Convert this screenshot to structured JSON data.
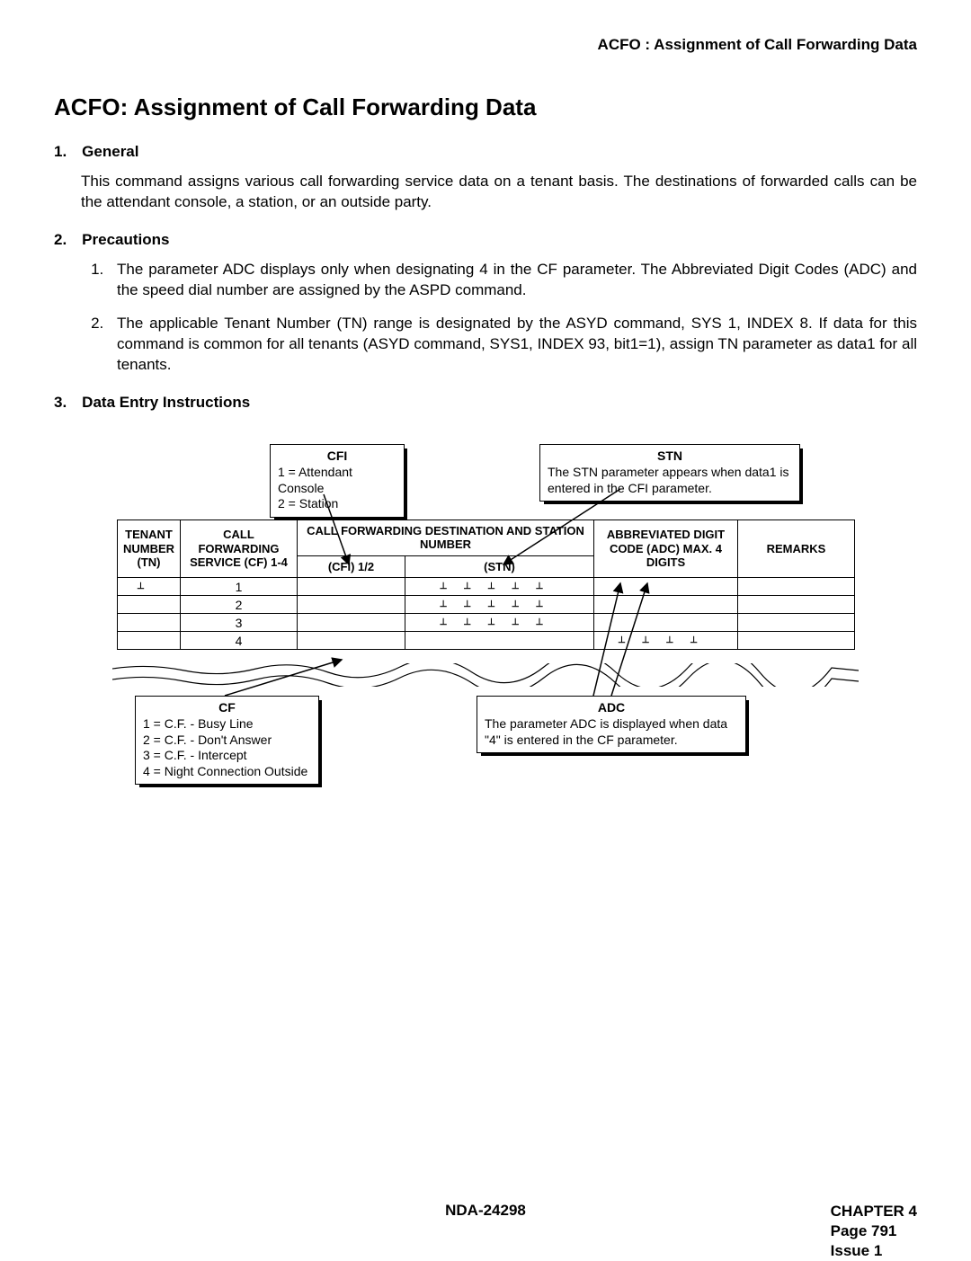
{
  "runningHeader": "ACFO : Assignment of Call Forwarding Data",
  "title": "ACFO: Assignment of Call Forwarding Data",
  "sections": {
    "general": {
      "heading": "1. General",
      "body": "This command assigns various call forwarding service data on a tenant basis. The destinations of forwarded calls can be the attendant console, a station, or an outside party."
    },
    "precautions": {
      "heading": "2. Precautions",
      "items": [
        "The parameter ADC displays only when designating 4 in the CF parameter. The Abbreviated Digit Codes (ADC) and the speed dial number are assigned by the ASPD command.",
        "The applicable Tenant Number (TN) range is designated by the ASYD command, SYS 1, INDEX 8. If data for this command is common for all tenants (ASYD command, SYS1, INDEX 93, bit1=1), assign TN parameter as data1 for all tenants."
      ]
    },
    "dataEntry": {
      "heading": "3. Data Entry Instructions"
    }
  },
  "callouts": {
    "cfi": {
      "title": "CFI",
      "lines": [
        "1 = Attendant Console",
        "2 = Station"
      ]
    },
    "stn": {
      "title": "STN",
      "lines": [
        "The STN parameter appears when data1 is entered in the CFI parameter."
      ]
    },
    "cf": {
      "title": "CF",
      "lines": [
        "1 = C.F. - Busy Line",
        "2 = C.F. - Don't Answer",
        "3 = C.F. - Intercept",
        "4 = Night Connection Outside"
      ]
    },
    "adc": {
      "title": "ADC",
      "lines": [
        "The parameter ADC is displayed when data \"4\" is entered in the CF parameter."
      ]
    }
  },
  "table": {
    "headers": {
      "tn": "TENANT NUMBER (TN)",
      "cf": "CALL FORWARDING SERVICE (CF) 1-4",
      "dest_group": "CALL FORWARDING DESTINATION AND STATION NUMBER",
      "cfi": "(CFI) 1/2",
      "stn": "(STN)",
      "adc": "ABBREVIATED DIGIT CODE (ADC) MAX. 4 DIGITS",
      "remarks": "REMARKS"
    },
    "cf_rows": [
      "1",
      "2",
      "3",
      "4"
    ]
  },
  "footer": {
    "center": "NDA-24298",
    "chapter": "CHAPTER 4",
    "page": "Page 791",
    "issue": "Issue 1"
  }
}
